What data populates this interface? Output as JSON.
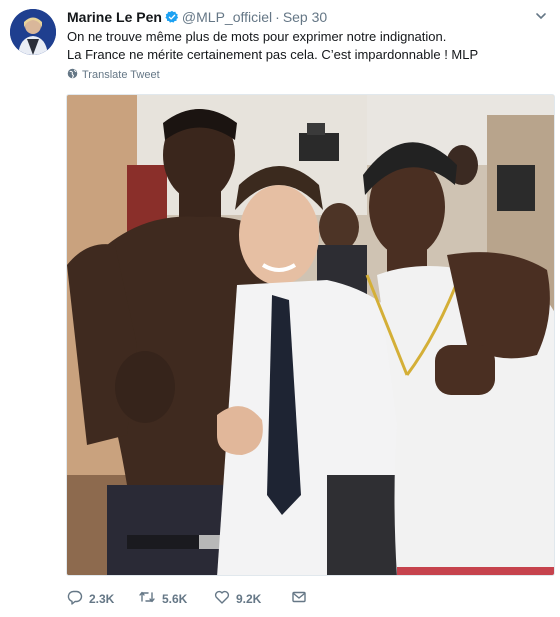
{
  "tweet": {
    "author_name": "Marine Le Pen",
    "author_handle": "@MLP_officiel",
    "separator": "·",
    "date": "Sep 30",
    "text_lines": [
      "On ne trouve même plus de mots pour exprimer notre indignation.",
      "La France ne mérite certainement pas cela. C’est impardonnable ! MLP"
    ],
    "translate_label": "Translate Tweet",
    "verified": true
  },
  "actions": {
    "replies": "2.3K",
    "retweets": "5.6K",
    "likes": "9.2K"
  },
  "icons": {
    "verified": "verified-badge-icon",
    "globe": "globe-icon",
    "reply": "reply-icon",
    "retweet": "retweet-icon",
    "like": "heart-icon",
    "message": "envelope-icon",
    "more": "chevron-down-icon"
  },
  "colors": {
    "verified_blue": "#1da1f2",
    "muted_text": "#657786",
    "primary_text": "#14171a"
  }
}
